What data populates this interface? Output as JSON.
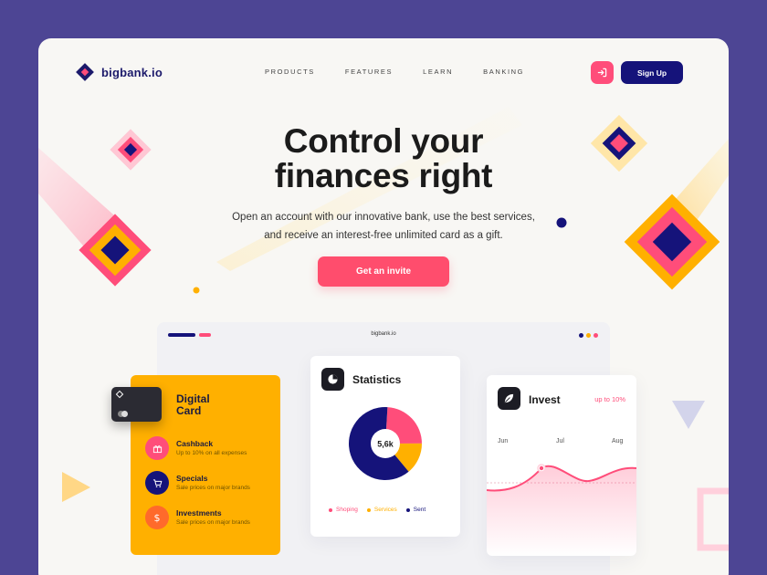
{
  "brand": {
    "name": "bigbank.io"
  },
  "nav": {
    "items": [
      "PRODUCTS",
      "FEATURES",
      "LEARN",
      "BANKING"
    ]
  },
  "header": {
    "signup_label": "Sign Up",
    "login_icon": "login-icon"
  },
  "hero": {
    "title_line1": "Control your",
    "title_line2": "finances right",
    "subtitle_line1": "Open an account with our innovative bank, use the best services,",
    "subtitle_line2": "and receive an interest-free unlimited card as a gift.",
    "cta_label": "Get an invite"
  },
  "browser": {
    "url": "bigbank.io"
  },
  "digital_card": {
    "title_line1": "Digital",
    "title_line2": "Card",
    "items": [
      {
        "title": "Cashback",
        "desc": "Up to 10% on all expenses",
        "icon": "gift-icon",
        "color": "#ff4d7a"
      },
      {
        "title": "Specials",
        "desc": "Sale prices on major brands",
        "icon": "cart-icon",
        "color": "#15137a"
      },
      {
        "title": "Investments",
        "desc": "Sale prices on major brands",
        "icon": "dollar-icon",
        "color": "#ff6a2b"
      }
    ]
  },
  "statistics": {
    "title": "Statistics",
    "center_value": "5,6k",
    "legend": [
      {
        "label": "Shoping",
        "color": "#ff4d7a",
        "share": 0.24
      },
      {
        "label": "Services",
        "color": "#ffb000",
        "share": 0.14
      },
      {
        "label": "Sent",
        "color": "#15137a",
        "share": 0.62
      }
    ]
  },
  "invest": {
    "title": "Invest",
    "badge": "up to 10%",
    "months": [
      "Jun",
      "Jul",
      "Aug"
    ]
  },
  "colors": {
    "primary": "#15137a",
    "accent": "#ff4d7a",
    "yellow": "#ffb000",
    "background": "#4d4594"
  }
}
